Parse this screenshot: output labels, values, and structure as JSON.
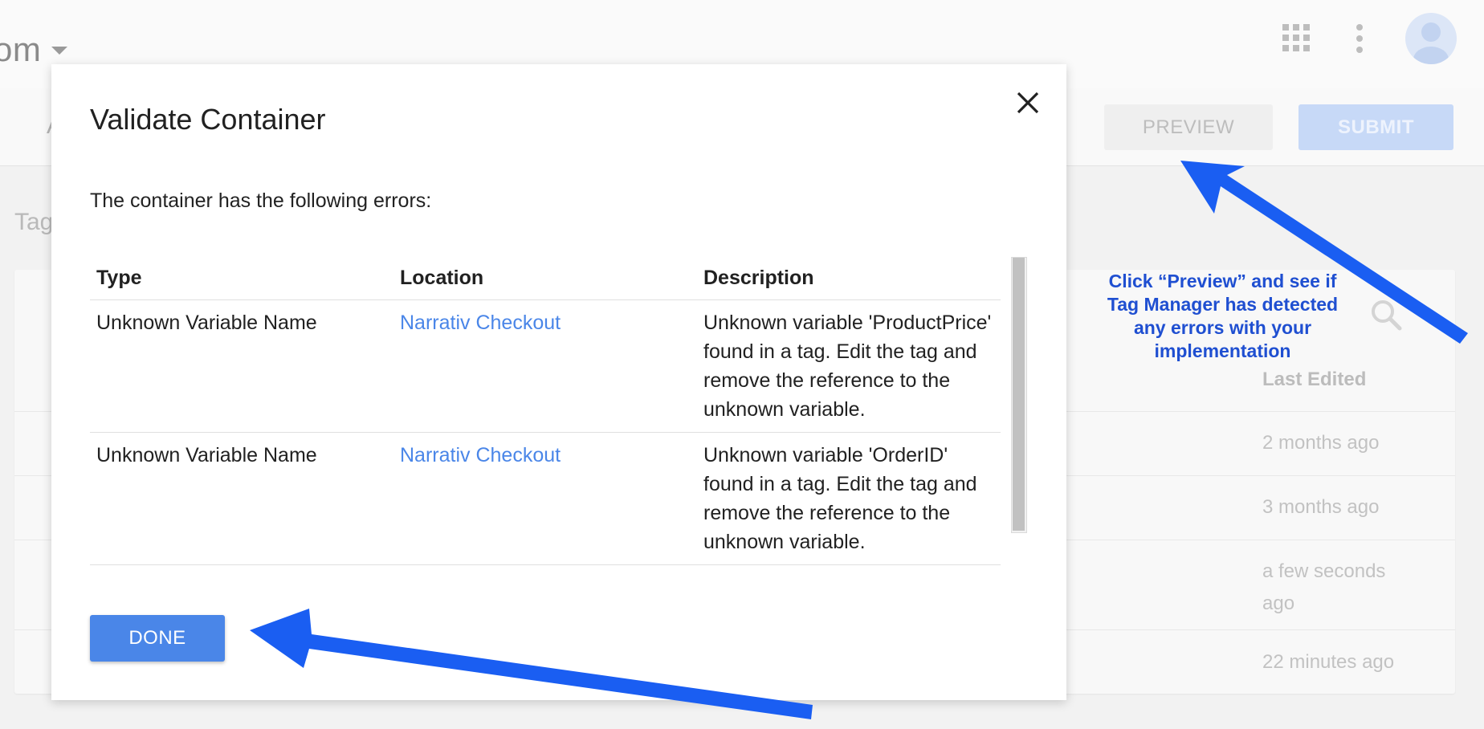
{
  "app": {
    "account_name": "om",
    "subbar_ghost": "A",
    "preview_label": "PREVIEW",
    "submit_label": "SUBMIT",
    "tags_heading": "Tag",
    "column_last_edited": "Last Edited",
    "rows_last_edited": [
      "2 months ago",
      "3 months ago",
      "a few seconds ago",
      "22 minutes ago"
    ]
  },
  "dialog": {
    "title": "Validate Container",
    "intro": "The container has the following errors:",
    "columns": [
      "Type",
      "Location",
      "Description"
    ],
    "errors": [
      {
        "type": "Unknown Variable Name",
        "location": "Narrativ Checkout",
        "description": "Unknown variable 'ProductPrice' found in a tag. Edit the tag and remove the reference to the unknown variable."
      },
      {
        "type": "Unknown Variable Name",
        "location": "Narrativ Checkout",
        "description": "Unknown variable 'OrderID' found in a tag. Edit the tag and remove the reference to the unknown variable."
      }
    ],
    "done_label": "DONE"
  },
  "annotation": {
    "text": "Click “Preview” and see if Tag Manager has detected any errors with your implementation",
    "arrow_color": "#1a5ef2",
    "text_color": "#1f4fd1"
  },
  "colors": {
    "link": "#4a86e8",
    "primary_button": "#4a86e8"
  }
}
